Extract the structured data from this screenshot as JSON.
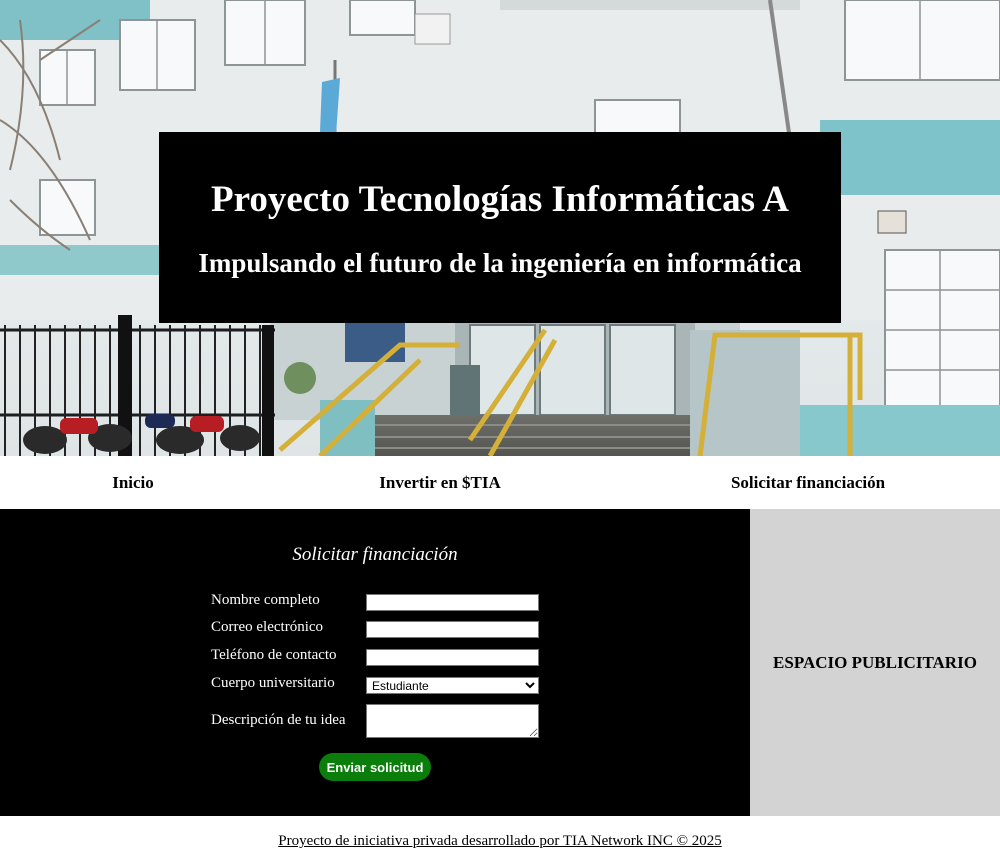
{
  "hero": {
    "title": "Proyecto Tecnologías Informáticas A",
    "subtitle": "Impulsando el futuro de la ingeniería en informática",
    "image_description": "building-facade-photo"
  },
  "nav": {
    "items": [
      {
        "label": "Inicio"
      },
      {
        "label": "Invertir en $TIA"
      },
      {
        "label": "Solicitar financiación"
      }
    ]
  },
  "form": {
    "title": "Solicitar financiación",
    "fields": {
      "name": {
        "label": "Nombre completo",
        "value": ""
      },
      "email": {
        "label": "Correo electrónico",
        "value": ""
      },
      "phone": {
        "label": "Teléfono de contacto",
        "value": ""
      },
      "body": {
        "label": "Cuerpo universitario",
        "selected": "Estudiante"
      },
      "description": {
        "label": "Descripción de tu idea",
        "value": ""
      }
    },
    "submit_label": "Enviar solicitud"
  },
  "ad": {
    "label": "ESPACIO PUBLICITARIO"
  },
  "footer": {
    "text": "Proyecto de iniciativa privada desarrollado por TIA Network INC © 2025"
  },
  "colors": {
    "hero_box": "#000000",
    "main_bg": "#000000",
    "ad_bg": "#d3d3d3",
    "submit_bg": "#0a7d0a"
  }
}
